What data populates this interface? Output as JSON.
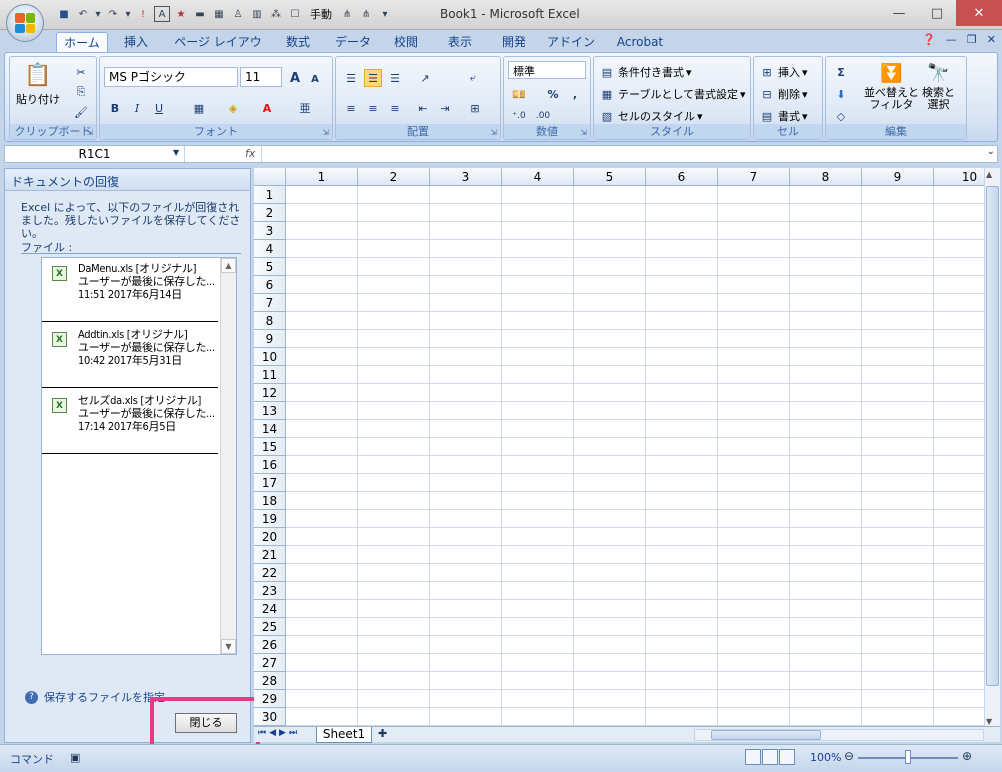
{
  "window": {
    "title": "Book1 - Microsoft Excel"
  },
  "qat": {
    "manual_label": "手動"
  },
  "tabs": [
    "ホーム",
    "挿入",
    "ページ レイアウト",
    "数式",
    "データ",
    "校閲",
    "表示",
    "開発",
    "アドイン",
    "Acrobat"
  ],
  "ribbon": {
    "clipboard": {
      "label": "クリップボード",
      "paste": "貼り付け"
    },
    "font": {
      "label": "フォント",
      "name": "MS Pゴシック",
      "size": "11",
      "bold": "B",
      "italic": "I",
      "underline": "U",
      "grow": "A",
      "shrink": "A"
    },
    "alignment": {
      "label": "配置"
    },
    "number": {
      "label": "数値",
      "format": "標準",
      "percent": "%",
      "comma": ","
    },
    "styles": {
      "label": "スタイル",
      "conditional": "条件付き書式",
      "table": "テーブルとして書式設定",
      "cell_style": "セルのスタイル"
    },
    "cells": {
      "label": "セル",
      "insert": "挿入",
      "delete": "削除",
      "format": "書式"
    },
    "editing": {
      "label": "編集",
      "sort": "並べ替えと",
      "sort2": "フィルタ",
      "find": "検索と",
      "find2": "選択"
    }
  },
  "formula_bar": {
    "name_box": "R1C1",
    "fx": "fx",
    "value": ""
  },
  "recovery": {
    "title": "ドキュメントの回復",
    "message": "Excel によって、以下のファイルが回復されました。残したいファイルを保存してください。",
    "files_label": "ファイル :",
    "files": [
      {
        "name": "DaMenu.xls  [オリジナル]",
        "desc": "ユーザーが最後に保存した...",
        "time": "11:51 2017年6月14日"
      },
      {
        "name": "Addtin.xls  [オリジナル]",
        "desc": "ユーザーが最後に保存した...",
        "time": "10:42 2017年5月31日"
      },
      {
        "name": "セルズda.xls  [オリジナル]",
        "desc": "ユーザーが最後に保存した...",
        "time": "17:14 2017年6月5日"
      }
    ],
    "help_link": "保存するファイルを指定",
    "close_button": "閉じる"
  },
  "sheet": {
    "columns": [
      "1",
      "2",
      "3",
      "4",
      "5",
      "6",
      "7",
      "8",
      "9",
      "10"
    ],
    "rows": [
      "1",
      "2",
      "3",
      "4",
      "5",
      "6",
      "7",
      "8",
      "9",
      "10",
      "11",
      "12",
      "13",
      "14",
      "15",
      "16",
      "17",
      "18",
      "19",
      "20",
      "21",
      "22",
      "23",
      "24",
      "25",
      "26",
      "27",
      "28",
      "29",
      "30"
    ],
    "tab": "Sheet1"
  },
  "status": {
    "mode": "コマンド",
    "zoom": "100%"
  },
  "colors": {
    "highlight": "#ea3a86"
  }
}
